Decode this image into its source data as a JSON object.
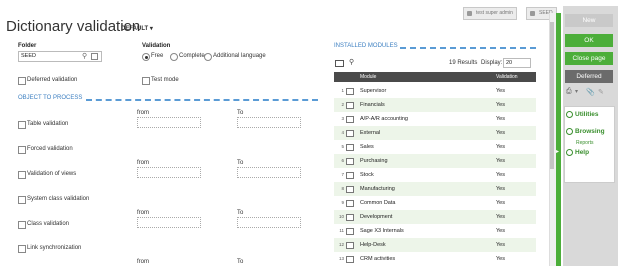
{
  "header": {
    "title": "Dictionary validation",
    "default_label": "DEFAULT",
    "user_button": "test super admin",
    "folder_button": "SEED"
  },
  "actions": {
    "new": "New",
    "ok": "OK",
    "close_page": "Close page",
    "deferred": "Deferred"
  },
  "side_links": {
    "utilities": "Utilities",
    "browsing": "Browsing",
    "reports": "Reports",
    "help": "Help"
  },
  "form": {
    "folder_label": "Folder",
    "folder_value": "SEED",
    "validation_label": "Validation",
    "radio_free": "Free",
    "radio_complete": "Complete",
    "radio_additional": "Additional language",
    "deferred_validation": "Deferred validation",
    "test_mode": "Test mode",
    "section_title": "OBJECT TO PROCESS",
    "from_label": "from",
    "to_label": "To",
    "rows": [
      {
        "label": "Table validation"
      },
      {
        "label": "Forced validation"
      },
      {
        "label": "Validation of views"
      },
      {
        "label": "System class validation"
      },
      {
        "label": "Class validation"
      },
      {
        "label": "Link synchronization"
      }
    ]
  },
  "modules": {
    "section_title": "INSTALLED MODULES",
    "results_text": "19 Results",
    "display_label": "Display:",
    "display_value": "20",
    "col_module": "Module",
    "col_validation": "Validation",
    "items": [
      {
        "n": "1",
        "module": "Supervisor",
        "validation": "Yes"
      },
      {
        "n": "2",
        "module": "Financials",
        "validation": "Yes"
      },
      {
        "n": "3",
        "module": "A/P-A/R accounting",
        "validation": "Yes"
      },
      {
        "n": "4",
        "module": "External",
        "validation": "Yes"
      },
      {
        "n": "5",
        "module": "Sales",
        "validation": "Yes"
      },
      {
        "n": "6",
        "module": "Purchasing",
        "validation": "Yes"
      },
      {
        "n": "7",
        "module": "Stock",
        "validation": "Yes"
      },
      {
        "n": "8",
        "module": "Manufacturing",
        "validation": "Yes"
      },
      {
        "n": "9",
        "module": "Common Data",
        "validation": "Yes"
      },
      {
        "n": "10",
        "module": "Development",
        "validation": "Yes"
      },
      {
        "n": "11",
        "module": "Sage X3 Internals",
        "validation": "Yes"
      },
      {
        "n": "12",
        "module": "Help-Desk",
        "validation": "Yes"
      },
      {
        "n": "13",
        "module": "CRM activities",
        "validation": "Yes"
      }
    ]
  }
}
